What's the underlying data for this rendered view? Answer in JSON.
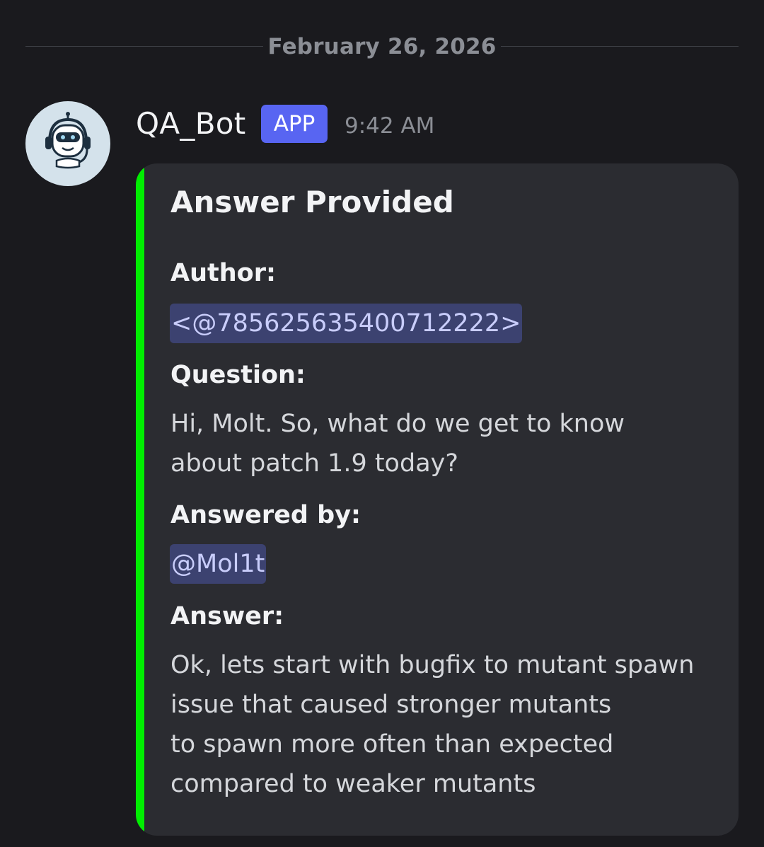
{
  "date_divider": "February 26, 2026",
  "message": {
    "username": "QA_Bot",
    "badge": "APP",
    "timestamp": "9:42 AM",
    "avatar_icon": "robot-headset-icon"
  },
  "embed": {
    "accent_color": "#00ee00",
    "title": "Answer Provided",
    "fields": {
      "author": {
        "name": "Author:",
        "value": "<@785625635400712222>"
      },
      "question": {
        "name": "Question:",
        "value": "Hi, Molt. So, what do we get to know\nabout patch 1.9 today?"
      },
      "answered_by": {
        "name": "Answered by:",
        "value": "@Mol1t"
      },
      "answer": {
        "name": "Answer:",
        "value": "Ok, lets start with bugfix to mutant spawn\nissue that caused stronger mutants\nto spawn more often than expected\ncompared to weaker mutants"
      }
    }
  },
  "colors": {
    "background": "#1a1a1e",
    "embed_background": "#2b2c31",
    "badge": "#5865f2",
    "mention_background": "#3c4270",
    "mention_text": "#c9cdfb"
  }
}
